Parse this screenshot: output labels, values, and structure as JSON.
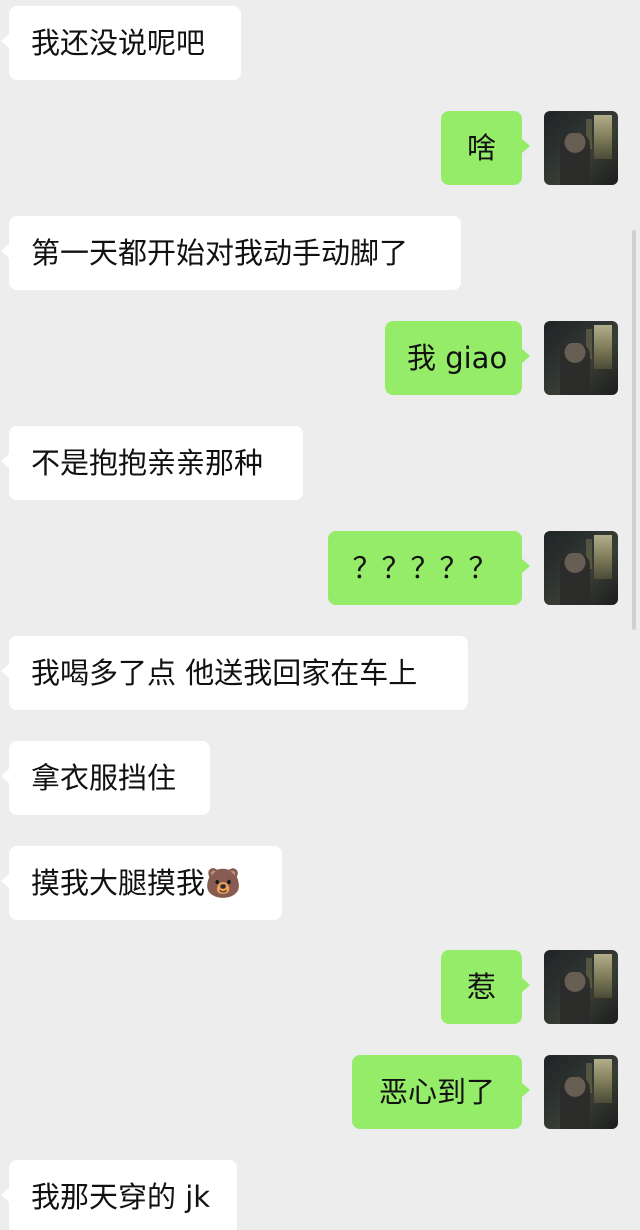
{
  "messages": [
    {
      "side": "left",
      "text": "我还没说呢吧"
    },
    {
      "side": "right",
      "text": "啥"
    },
    {
      "side": "left",
      "text": "第一天都开始对我动手动脚了"
    },
    {
      "side": "right",
      "text": "我 giao"
    },
    {
      "side": "left",
      "text": "不是抱抱亲亲那种"
    },
    {
      "side": "right",
      "text": "？？？？？"
    },
    {
      "side": "left",
      "text": "我喝多了点 他送我回家在车上"
    },
    {
      "side": "left",
      "text": "拿衣服挡住"
    },
    {
      "side": "left",
      "text": "摸我大腿摸我🐻"
    },
    {
      "side": "right",
      "text": "惹"
    },
    {
      "side": "right",
      "text": "恶心到了"
    },
    {
      "side": "left",
      "text": "我那天穿的 jk"
    }
  ],
  "colors": {
    "background": "#ededed",
    "incoming_bubble": "#ffffff",
    "outgoing_bubble": "#95ec69"
  },
  "icons": {
    "avatar": "user-avatar-icon"
  }
}
